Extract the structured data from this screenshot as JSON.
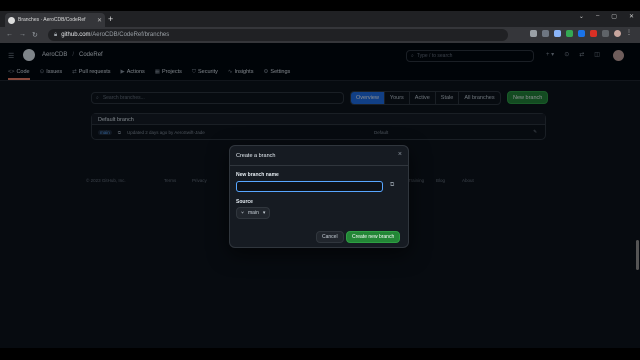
{
  "browser": {
    "tab_title": "Branches · AeroCDB/CodeRef",
    "new_tab": "+",
    "url_host": "github.com",
    "url_path": "/AeroCDB/CodeRef/branches",
    "window_controls": [
      "⌄",
      "–",
      "▢",
      "✕"
    ]
  },
  "header": {
    "owner": "AeroCDB",
    "separator": "/",
    "repo": "CodeRef",
    "search_placeholder": "Type / to search"
  },
  "repo_nav": [
    {
      "icon": "<>",
      "label": "Code"
    },
    {
      "icon": "⊙",
      "label": "Issues"
    },
    {
      "icon": "⇄",
      "label": "Pull requests"
    },
    {
      "icon": "▶",
      "label": "Actions"
    },
    {
      "icon": "▦",
      "label": "Projects"
    },
    {
      "icon": "⛉",
      "label": "Security"
    },
    {
      "icon": "∿",
      "label": "Insights"
    },
    {
      "icon": "⚙",
      "label": "Settings"
    }
  ],
  "branches": {
    "search_placeholder": "Search branches...",
    "filters": [
      "Overview",
      "Yours",
      "Active",
      "Stale",
      "All branches"
    ],
    "new_branch_label": "New branch",
    "default_box_title": "Default branch",
    "default_branch": {
      "name": "main",
      "updated": "Updated 2 days ago by AeroSwift-Jade",
      "label": "Default"
    }
  },
  "footer": [
    "© 2023 GitHub, Inc.",
    "Terms",
    "Privacy",
    "Training",
    "Blog",
    "About"
  ],
  "dialog": {
    "title": "Create a branch",
    "close": "×",
    "name_label": "New branch name",
    "name_value": "",
    "source_label": "Source",
    "source_value": "main",
    "cancel_label": "Cancel",
    "create_label": "Create new branch"
  },
  "colors": {
    "accent_blue": "#1f6feb",
    "primary_green": "#238636",
    "page_bg": "#0d1117"
  }
}
